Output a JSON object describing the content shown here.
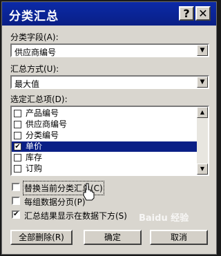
{
  "dialog": {
    "title": "分类汇总",
    "help_label": "?",
    "close_label": "✕"
  },
  "group_by": {
    "label": "分类字段(A):",
    "value": "供应商编号"
  },
  "function": {
    "label": "汇总方式(U):",
    "value": "最大值"
  },
  "fields": {
    "label": "选定汇总项(D):",
    "items": [
      {
        "label": "产品编号",
        "checked": false,
        "selected": false
      },
      {
        "label": "供应商编号",
        "checked": false,
        "selected": false
      },
      {
        "label": "分类编号",
        "checked": false,
        "selected": false
      },
      {
        "label": "单价",
        "checked": true,
        "selected": true
      },
      {
        "label": "库存",
        "checked": false,
        "selected": false
      },
      {
        "label": "订购",
        "checked": false,
        "selected": false
      }
    ]
  },
  "options": {
    "replace_current": {
      "label": "替换当前分类汇总(C)",
      "checked": false
    },
    "page_break": {
      "label": "每组数据分页(P)",
      "checked": false
    },
    "summary_below": {
      "label": "汇总结果显示在数据下方(S)",
      "checked": true
    }
  },
  "buttons": {
    "remove_all": "全部删除(R)",
    "ok": "确定",
    "cancel": "取消"
  },
  "watermark": "Baidu 经验",
  "colors": {
    "titlebar": "#0a1f86",
    "selection": "#0a1f86",
    "dialog_bg": "#d9d6cf"
  }
}
